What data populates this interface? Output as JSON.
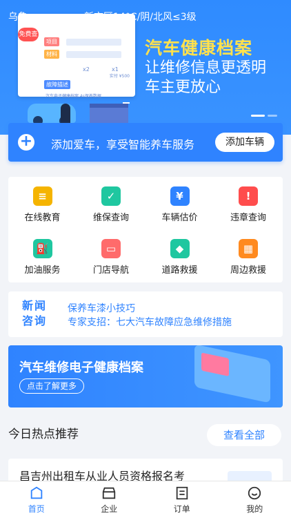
{
  "status": {
    "city": "乌鲁",
    "weather": "新市区14°C/阴/北风≤3级"
  },
  "hero": {
    "title1": "汽车健康档案",
    "title2": "让维修信息更透明",
    "title3": "车主更放心",
    "card": {
      "tag": "免费查",
      "label_project": "项目",
      "label_material": "材料",
      "label_fault": "故障描述",
      "qty1": "x2",
      "qty2": "x1",
      "paid": "实付 ¥500",
      "footer": "汽车电子健康档案,4s保养数据"
    }
  },
  "add_car": {
    "text": "添加爱车，享受智能养车服务",
    "button": "添加车辆"
  },
  "services": [
    {
      "label": "在线教育",
      "icon": "book-icon",
      "color": "#f5b400",
      "glyph": "≡"
    },
    {
      "label": "维保查询",
      "icon": "shield-check-icon",
      "color": "#1fc7a0",
      "glyph": "✓"
    },
    {
      "label": "车辆估价",
      "icon": "yen-coin-icon",
      "color": "#2f83ff",
      "glyph": "¥"
    },
    {
      "label": "违章查询",
      "icon": "warning-icon",
      "color": "#ff4d4d",
      "glyph": "!"
    },
    {
      "label": "加油服务",
      "icon": "fuel-pump-icon",
      "color": "#1fc7a0",
      "glyph": "⛽"
    },
    {
      "label": "门店导航",
      "icon": "store-icon",
      "color": "#ff6b6b",
      "glyph": "▭"
    },
    {
      "label": "道路救援",
      "icon": "tag-icon",
      "color": "#1fc7a0",
      "glyph": "◆"
    },
    {
      "label": "周边救援",
      "icon": "grid-icon",
      "color": "#ff8a1f",
      "glyph": "▦"
    }
  ],
  "news": {
    "badge_line1": "新闻",
    "badge_line2": "咨询",
    "items": [
      "保养车漆小技巧",
      "专家支招：七大汽车故障应急维修措施"
    ]
  },
  "promo": {
    "title": "汽车维修电子健康档案",
    "button": "点击了解更多"
  },
  "hot": {
    "title": "今日热点推荐",
    "see_all": "查看全部"
  },
  "article": {
    "title": "昌吉州出租车从业人员资格报名考"
  },
  "tabs": [
    {
      "label": "首页",
      "icon": "home-icon",
      "active": true
    },
    {
      "label": "企业",
      "icon": "enterprise-icon",
      "active": false
    },
    {
      "label": "订单",
      "icon": "order-icon",
      "active": false
    },
    {
      "label": "我的",
      "icon": "profile-icon",
      "active": false
    }
  ],
  "colors": {
    "accent": "#2f83ff",
    "hero_title": "#ffe14d"
  }
}
